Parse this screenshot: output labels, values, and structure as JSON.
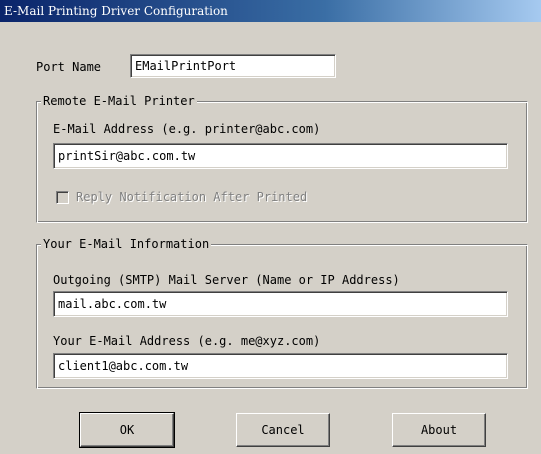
{
  "window": {
    "title": "E-Mail Printing Driver Configuration"
  },
  "port": {
    "label": "Port Name",
    "value": "EMailPrintPort"
  },
  "remote_printer": {
    "group_title": "Remote E-Mail Printer",
    "email_label": "E-Mail Address (e.g. printer@abc.com)",
    "email_value": "printSir@abc.com.tw",
    "reply_notification_label": "Reply Notification After Printed",
    "reply_notification_checked": false,
    "reply_notification_enabled": false
  },
  "your_info": {
    "group_title": "Your E-Mail Information",
    "smtp_label": "Outgoing (SMTP) Mail Server (Name or IP Address)",
    "smtp_value": "mail.abc.com.tw",
    "email_label": "Your E-Mail Address (e.g. me@xyz.com)",
    "email_value": "client1@abc.com.tw"
  },
  "buttons": {
    "ok_label": "OK",
    "cancel_label": "Cancel",
    "about_label": "About"
  },
  "colors": {
    "title_bar_start": "#0a246a",
    "title_bar_end": "#a6caf0",
    "dialog_face": "#d4d0c8"
  }
}
